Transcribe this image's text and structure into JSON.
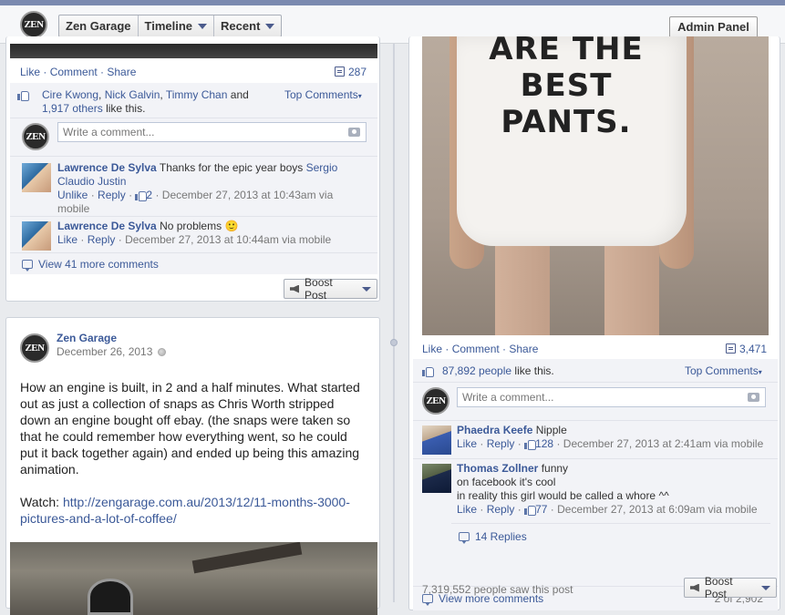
{
  "topbar": {
    "logo_text": "ZEN",
    "nav": [
      "Zen Garage",
      "Timeline",
      "Recent"
    ],
    "admin_label": "Admin Panel"
  },
  "left_post1": {
    "actions": {
      "like": "Like",
      "comment": "Comment",
      "share": "Share"
    },
    "share_count": "287",
    "likes": {
      "names": [
        "Cire Kwong",
        "Nick Galvin",
        "Timmy Chan"
      ],
      "and": "and",
      "others": "1,917 others",
      "suffix": "like this."
    },
    "top_comments": "Top Comments",
    "comment_placeholder": "Write a comment...",
    "comments": [
      {
        "author": "Lawrence De Sylva",
        "text": "Thanks for the epic year boys",
        "tag1": "Sergio",
        "tag2": "Claudio Justin",
        "unlike": "Unlike",
        "reply": "Reply",
        "likes": "2",
        "meta_line1": "December 27, 2013 at 10:43am via",
        "meta_line2": "mobile"
      },
      {
        "author": "Lawrence De Sylva",
        "text": "No problems",
        "emoji": "🙂",
        "like": "Like",
        "reply": "Reply",
        "meta": "December 27, 2013 at 10:44am via mobile"
      }
    ],
    "view_more": "View 41 more comments",
    "boost": "Boost Post"
  },
  "left_post2": {
    "page_name": "Zen Garage",
    "date": "December 26, 2013",
    "body": "How an engine is built, in 2 and a half minutes. What started out as just a collection of snaps as Chris Worth stripped down an engine bought off ebay. (the snaps were taken so that he could remember how everything went, so he could put it back together again) and ended up being this amazing animation.",
    "watch_label": "Watch:",
    "watch_link": "http://zengarage.com.au/2013/12/11-months-3000-pictures-and-a-lot-of-coffee/"
  },
  "right_post": {
    "shirt_lines": [
      "ARE THE",
      "BEST",
      "PANTS."
    ],
    "actions": {
      "like": "Like",
      "comment": "Comment",
      "share": "Share"
    },
    "share_count": "3,471",
    "likes_count": "87,892 people",
    "likes_suffix": "like this.",
    "top_comments": "Top Comments",
    "comment_placeholder": "Write a comment...",
    "comments": [
      {
        "author": "Phaedra Keefe",
        "text": "Nipple",
        "like": "Like",
        "reply": "Reply",
        "likes": "128",
        "meta": "December 27, 2013 at 2:41am via mobile"
      },
      {
        "author": "Thomas Zollner",
        "text": "funny",
        "line2": "on facebook it's cool",
        "line3": "in reality this girl would be called a whore ^^",
        "like": "Like",
        "reply": "Reply",
        "likes": "77",
        "meta": "December 27, 2013 at 6:09am via mobile"
      }
    ],
    "replies": "14 Replies",
    "view_more": "View more comments",
    "pager": "2 of 2,902",
    "seen": "7,319,552 people saw this post",
    "boost": "Boost Post"
  }
}
